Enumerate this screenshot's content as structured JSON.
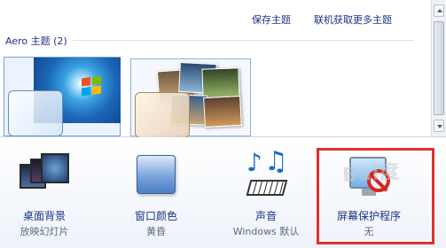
{
  "header": {
    "save_theme_link": "保存主题",
    "get_more_themes_link": "联机获取更多主题"
  },
  "aero_group": {
    "title": "Aero 主题 (2)",
    "themes": [
      {
        "name": "windows-7",
        "selected": true
      },
      {
        "name": "landscape-slideshow",
        "selected": false
      }
    ]
  },
  "bottom_bar": {
    "items": [
      {
        "id": "desktop-background",
        "label": "桌面背景",
        "sub": "放映幻灯片",
        "icon": "desktop-background-icon"
      },
      {
        "id": "window-color",
        "label": "窗口颜色",
        "sub": "黄昏",
        "icon": "window-color-icon"
      },
      {
        "id": "sounds",
        "label": "声音",
        "sub": "Windows 默认",
        "icon": "sound-icon"
      },
      {
        "id": "screen-saver",
        "label": "屏幕保护程序",
        "sub": "无",
        "icon": "screen-saver-icon"
      }
    ]
  },
  "annotation": {
    "highlight_color": "#e0312e"
  },
  "watermark": {
    "text": "Bai度"
  }
}
